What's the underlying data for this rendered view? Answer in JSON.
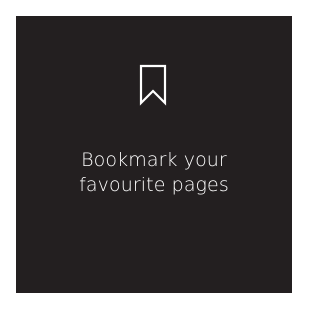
{
  "card": {
    "icon": "bookmark-icon",
    "message_line1": "Bookmark your",
    "message_line2": "favourite pages",
    "background_color": "#231f20",
    "text_color": "#ffffff"
  }
}
